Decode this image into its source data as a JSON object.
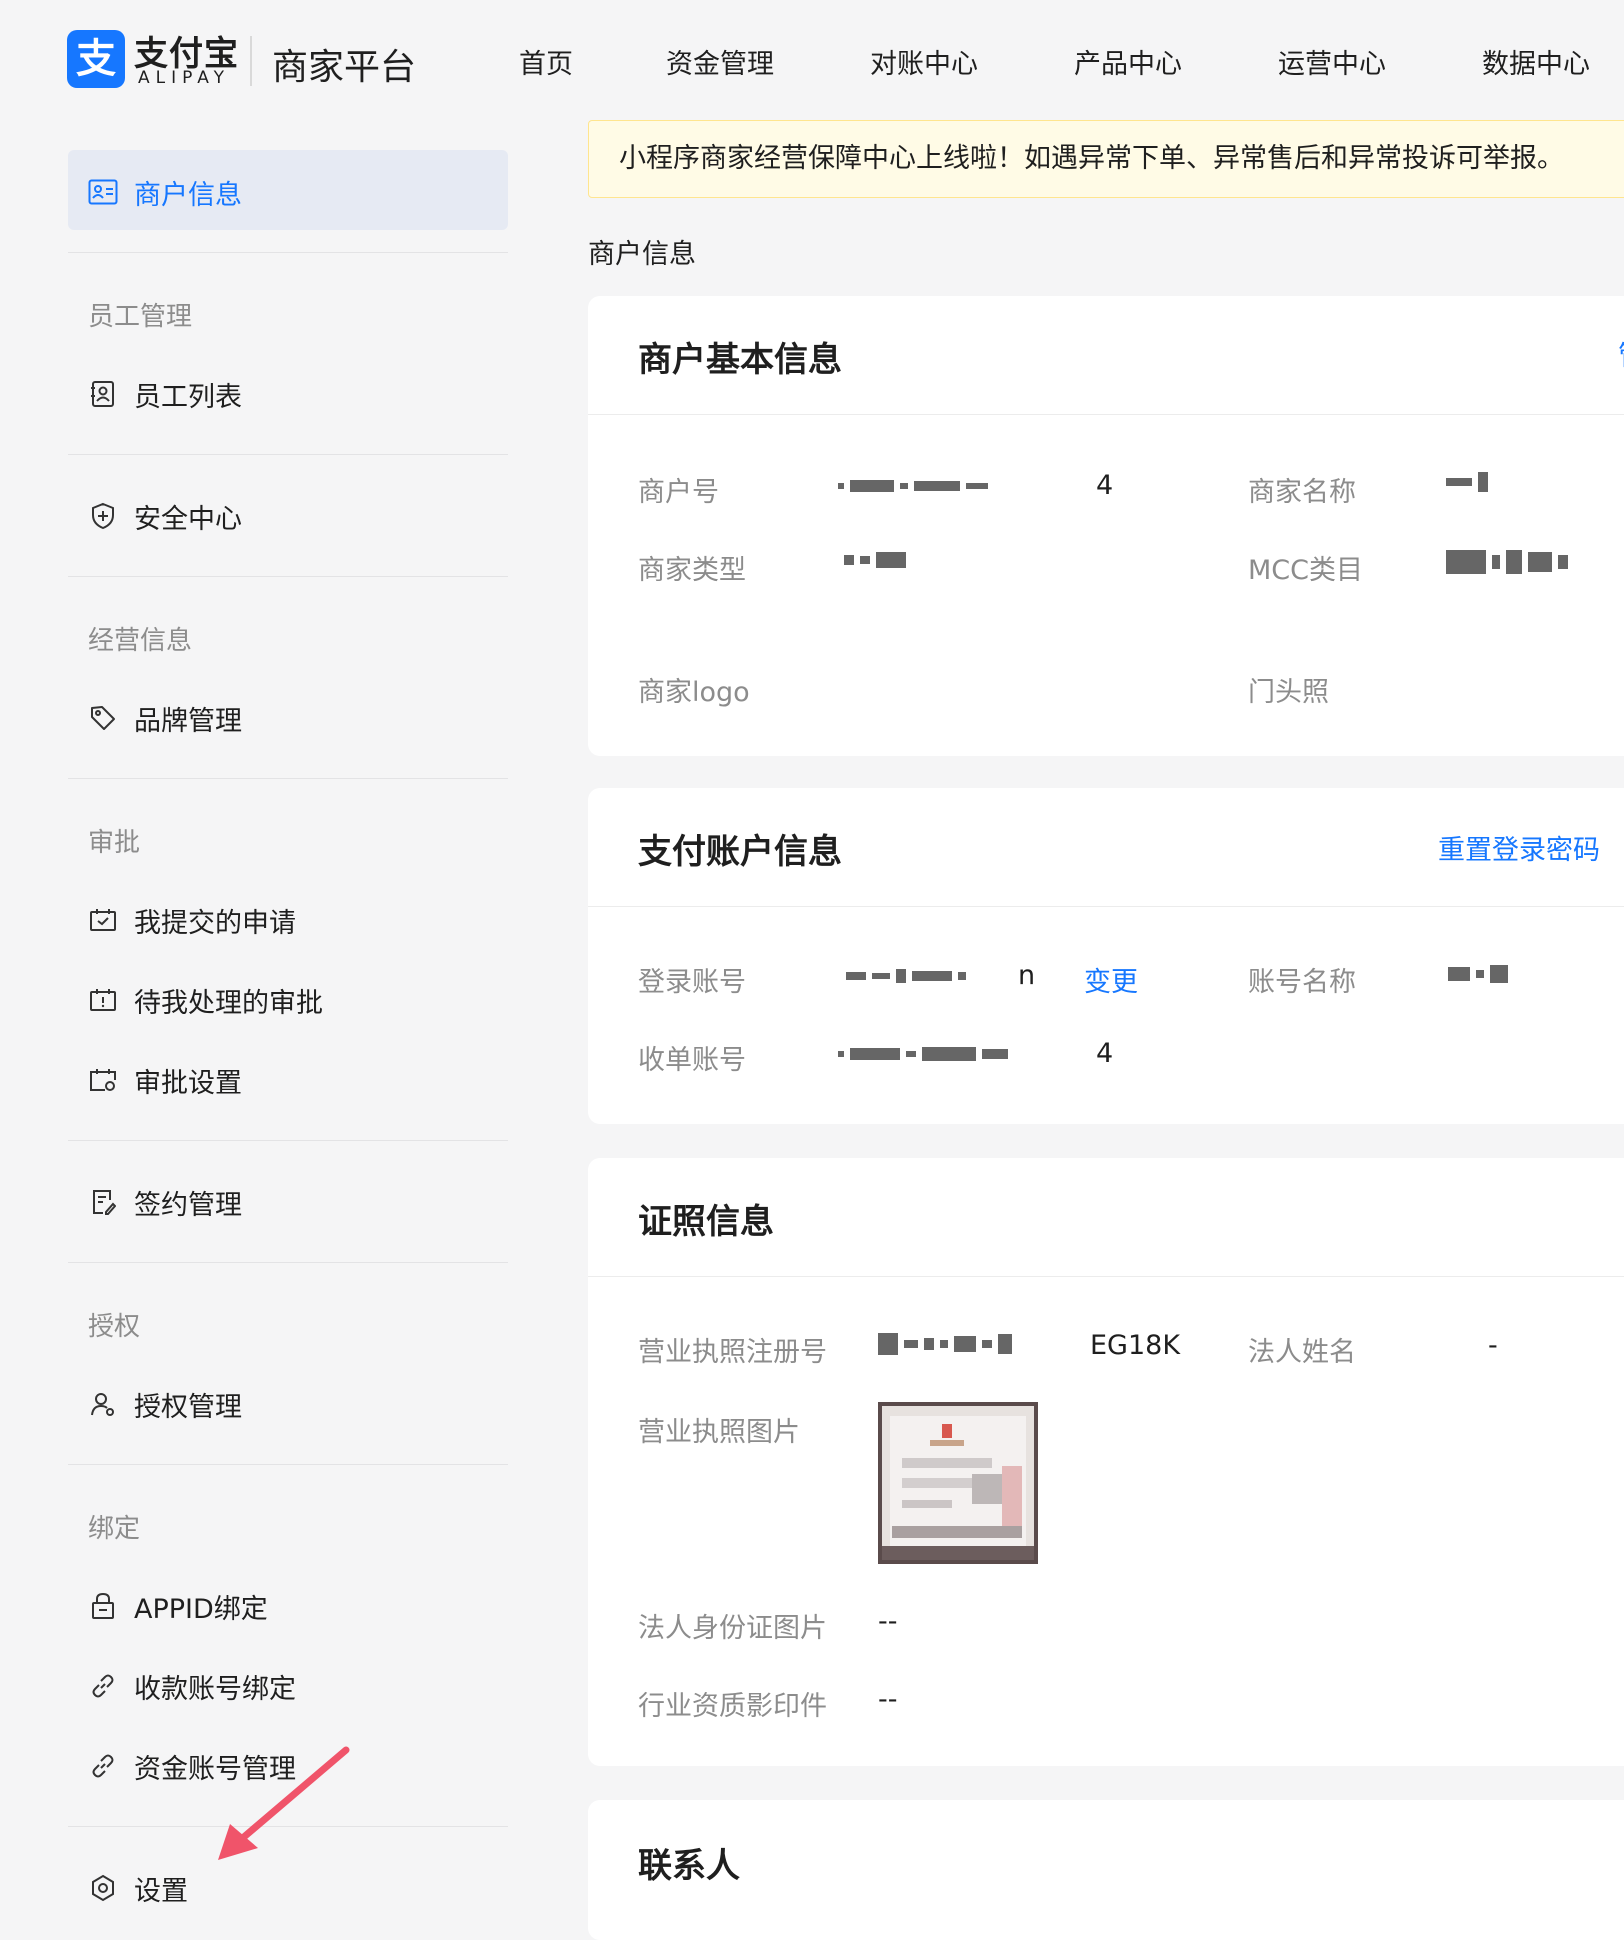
{
  "header": {
    "logo_cn": "支付宝",
    "logo_en": "ALIPAY",
    "logo_glyph": "支",
    "platform": "商家平台",
    "nav": [
      "首页",
      "资金管理",
      "对账中心",
      "产品中心",
      "运营中心",
      "数据中心"
    ]
  },
  "sidebar": {
    "active": {
      "label": "商户信息",
      "icon": "id-card-icon"
    },
    "group_staff": "员工管理",
    "staff_list": {
      "label": "员工列表",
      "icon": "staff-icon"
    },
    "security": {
      "label": "安全中心",
      "icon": "shield-icon"
    },
    "group_business": "经营信息",
    "brand": {
      "label": "品牌管理",
      "icon": "tag-icon"
    },
    "group_approval": "审批",
    "my_requests": {
      "label": "我提交的申请",
      "icon": "calendar-check-icon"
    },
    "pending": {
      "label": "待我处理的审批",
      "icon": "calendar-alert-icon"
    },
    "approval_settings": {
      "label": "审批设置",
      "icon": "calendar-gear-icon"
    },
    "contract": {
      "label": "签约管理",
      "icon": "document-edit-icon"
    },
    "group_auth": "授权",
    "auth_manage": {
      "label": "授权管理",
      "icon": "user-key-icon"
    },
    "group_bind": "绑定",
    "appid_bind": {
      "label": "APPID绑定",
      "icon": "lock-icon"
    },
    "account_bind": {
      "label": "收款账号绑定",
      "icon": "link-icon"
    },
    "fund_account": {
      "label": "资金账号管理",
      "icon": "link-icon"
    },
    "settings": {
      "label": "设置",
      "icon": "hexagon-gear-icon"
    }
  },
  "notice": "小程序商家经营保障中心上线啦！如遇异常下单、异常售后和异常投诉可举报。",
  "breadcrumb": "商户信息",
  "basic_info": {
    "title": "商户基本信息",
    "merchant_id_label": "商户号",
    "merchant_id_suffix": "4",
    "merchant_name_label": "商家名称",
    "merchant_type_label": "商家类型",
    "mcc_label": "MCC类目",
    "logo_label": "商家logo",
    "storefront_label": "门头照"
  },
  "account_info": {
    "title": "支付账户信息",
    "reset_link": "重置登录密码",
    "login_label": "登录账号",
    "login_suffix": "n",
    "change_link": "变更",
    "account_name_label": "账号名称",
    "receipt_label": "收单账号",
    "receipt_suffix": "4"
  },
  "license_info": {
    "title": "证照信息",
    "reg_no_label": "营业执照注册号",
    "reg_no_suffix": "EG18K",
    "legal_name_label": "法人姓名",
    "legal_name_value": "-",
    "license_img_label": "营业执照图片",
    "id_img_label": "法人身份证图片",
    "id_img_value": "--",
    "qualification_label": "行业资质影印件",
    "qualification_value": "--"
  },
  "contact": {
    "title": "联系人"
  },
  "colors": {
    "accent": "#1677ff",
    "annotation_arrow": "#f0546a"
  }
}
